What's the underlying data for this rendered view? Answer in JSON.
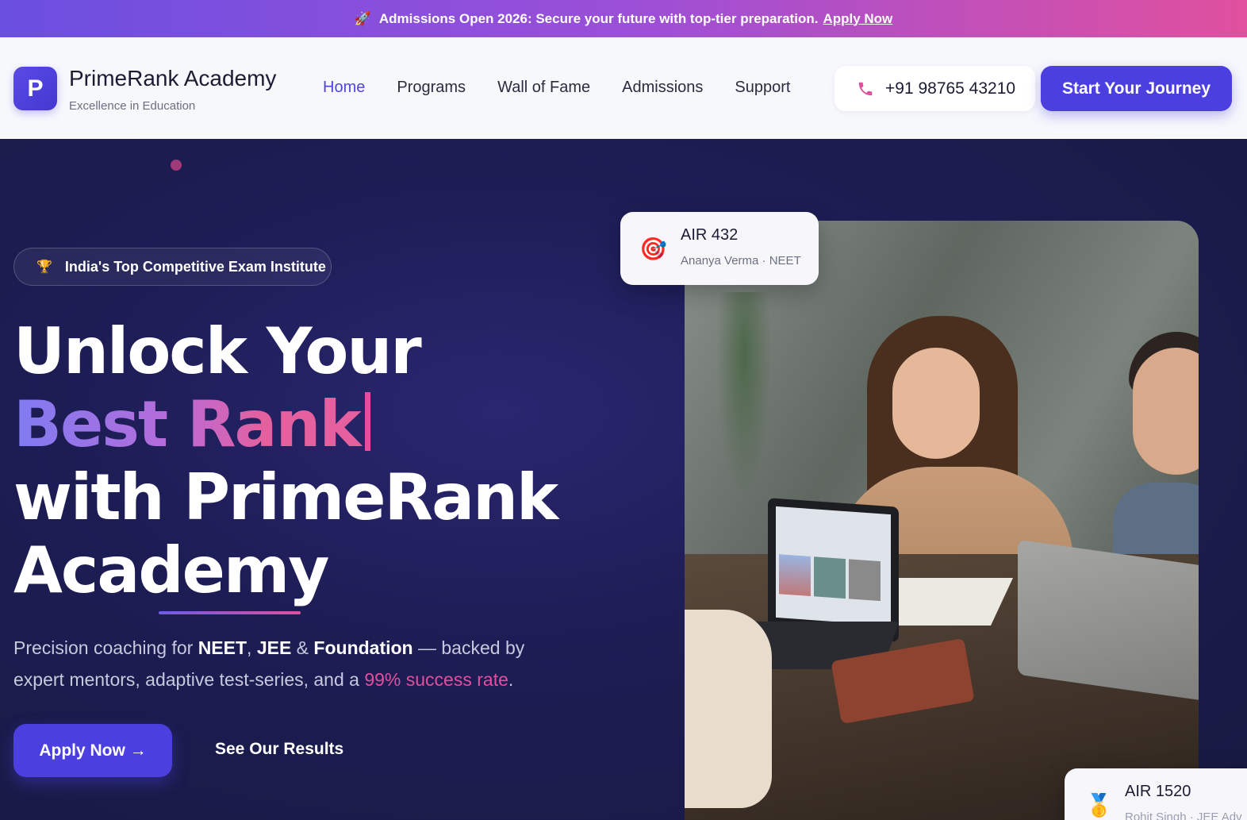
{
  "announcement": {
    "icon": "rocket-icon",
    "text": "Admissions Open 2026: Secure your future with top-tier preparation.",
    "link": "Apply Now"
  },
  "header": {
    "logo_letter": "P",
    "brand_name": "PrimeRank Academy",
    "tagline": "Excellence in Education",
    "nav": [
      {
        "label": "Home",
        "active": true
      },
      {
        "label": "Programs",
        "active": false
      },
      {
        "label": "Wall of Fame",
        "active": false
      },
      {
        "label": "Admissions",
        "active": false
      },
      {
        "label": "Support",
        "active": false
      }
    ],
    "phone": "+91 98765 43210",
    "cta": "Start Your Journey"
  },
  "hero": {
    "badge": "India's Top Competitive Exam Institute",
    "badge_icon": "trophy-icon",
    "headline": {
      "line1": "Unlock Your",
      "line2": "Best Rank",
      "line3": "with PrimeRank",
      "line4": "Academy"
    },
    "description": {
      "p1": "Precision coaching for ",
      "b1": "NEET",
      "p2": ", ",
      "b2": "JEE",
      "p3": " & ",
      "b3": "Foundation",
      "p4": " — backed by expert mentors, adaptive test-series, and a ",
      "highlight": "99% success rate",
      "p5": "."
    },
    "primary_button": "Apply Now →",
    "secondary_button": "See Our Results"
  },
  "cards": [
    {
      "icon": "target-icon",
      "title": "AIR 432",
      "subtitle": "Ananya Verma · NEET"
    },
    {
      "icon": "medal-icon",
      "title": "AIR 1520",
      "subtitle": "Rohit Singh · JEE Adv"
    }
  ],
  "colors": {
    "accent": "#4b3fe0",
    "pink": "#e0509e",
    "hero_bg": "#1d1d55"
  }
}
